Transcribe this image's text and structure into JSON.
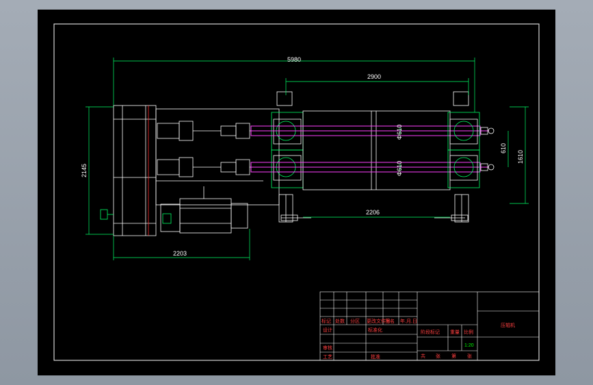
{
  "dimensions": {
    "overall_length": "5980",
    "roll_length": "2900",
    "left_height": "2145",
    "right_width": "1610",
    "center_distance": "610",
    "roll_dia_top": "Φ610",
    "roll_dia_bottom": "Φ610",
    "roll_span": "2206",
    "base_length": "2203"
  },
  "title_block": {
    "drawing_title": "压辊机",
    "row_labels": [
      "标记",
      "处数",
      "分区",
      "更改文件号",
      "签名",
      "年.月.日"
    ],
    "design": "设计",
    "standardization": "标准化",
    "review": "审核",
    "process": "工艺",
    "approve": "批准",
    "stage_mark": "阶段标记",
    "weight": "重量",
    "scale": "比例",
    "scale_value": "1:20",
    "sheet_info": [
      "共",
      "张",
      "第",
      "张"
    ]
  }
}
